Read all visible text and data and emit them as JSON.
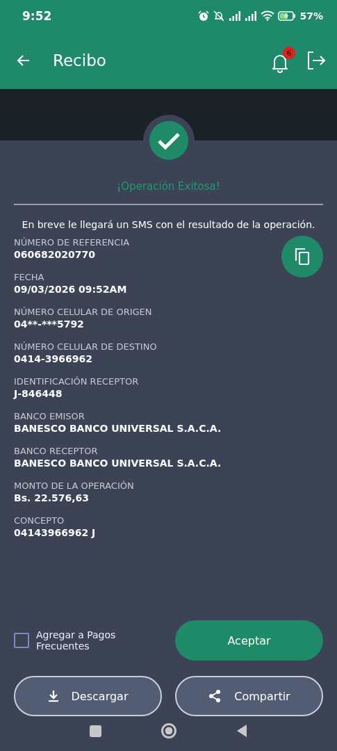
{
  "status_bar": {
    "time": "9:52",
    "battery": "57%"
  },
  "app_bar": {
    "title": "Recibo",
    "notification_count": "6"
  },
  "receipt": {
    "status": "¡Operación Exitosa!",
    "message": "En breve le llegará un SMS con el resultado de la operación.",
    "fields": [
      {
        "label": "NÚMERO DE REFERENCIA",
        "value": "060682020770"
      },
      {
        "label": "FECHA",
        "value": "09/03/2026 09:52AM"
      },
      {
        "label": "NÚMERO CELULAR DE ORIGEN",
        "value": "04**-***5792"
      },
      {
        "label": "NÚMERO CELULAR DE DESTINO",
        "value": "0414-3966962"
      },
      {
        "label": "IDENTIFICACIÓN RECEPTOR",
        "value": "J-846448"
      },
      {
        "label": "BANCO EMISOR",
        "value": "BANESCO BANCO UNIVERSAL S.A.C.A."
      },
      {
        "label": "BANCO RECEPTOR",
        "value": "BANESCO BANCO UNIVERSAL S.A.C.A."
      },
      {
        "label": "MONTO DE LA OPERACIÓN",
        "value": "Bs. 22.576,63"
      },
      {
        "label": "CONCEPTO",
        "value": "04143966962 J"
      }
    ]
  },
  "frequent_payment": {
    "label": "Agregar a Pagos Frecuentes",
    "checked": false
  },
  "buttons": {
    "accept": "Aceptar",
    "download": "Descargar",
    "share": "Compartir"
  }
}
